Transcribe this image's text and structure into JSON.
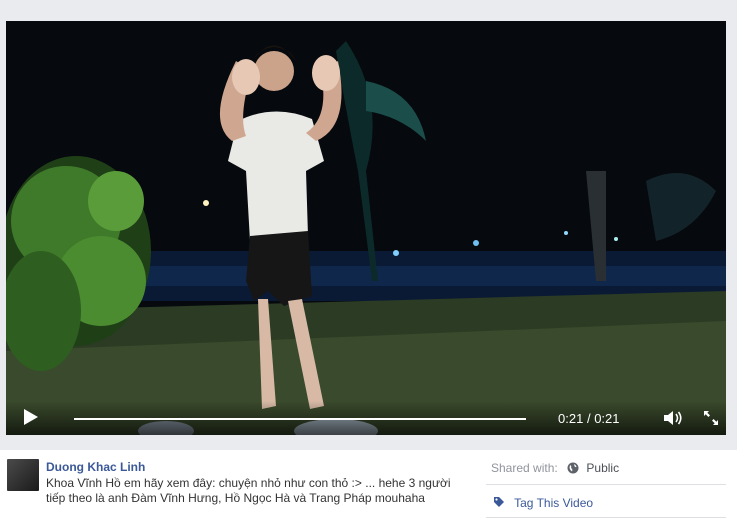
{
  "video": {
    "current_time": "0:21",
    "separator": "/",
    "duration": "0:21",
    "progress": 1.0
  },
  "post": {
    "author": "Duong Khac Linh",
    "caption": "Khoa Vĩnh Hồ em hãy xem đây: chuyện nhỏ như con thỏ :> ... hehe 3 người tiếp theo là anh Đàm Vĩnh Hưng, Hồ Ngọc Hà và Trang Pháp mouhaha"
  },
  "sidebar": {
    "shared_with_label": "Shared with:",
    "privacy": "Public",
    "tag_label": "Tag This Video"
  },
  "colors": {
    "link": "#3b5998",
    "muted": "#90949c"
  }
}
